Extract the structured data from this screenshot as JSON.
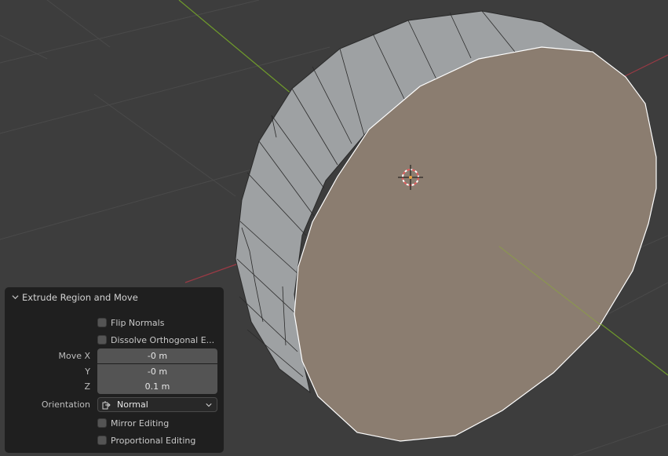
{
  "panel": {
    "title": "Extrude Region and Move",
    "flip_normals": "Flip Normals",
    "dissolve_orthogonal": "Dissolve Orthogonal E...",
    "move_x_label": "Move X",
    "move_y_label": "Y",
    "move_z_label": "Z",
    "move_x_value": "-0 m",
    "move_y_value": "-0 m",
    "move_z_value": "0.1 m",
    "orientation_label": "Orientation",
    "orientation_value": "Normal",
    "mirror_editing": "Mirror Editing",
    "proportional_editing": "Proportional Editing"
  },
  "colors": {
    "viewport_bg": "#3d3d3d",
    "grid_line": "#4a4a4a",
    "x_axis": "#9b3a45",
    "y_axis": "#6f9a2c",
    "selected_face": "#8b7d70",
    "side_face": "#9ea1a3",
    "panel_bg": "#1e1e1e"
  },
  "icons": {
    "collapse": "chevron-down-icon",
    "orientation": "orientation-transform-icon",
    "cursor": "3d-cursor-icon"
  }
}
